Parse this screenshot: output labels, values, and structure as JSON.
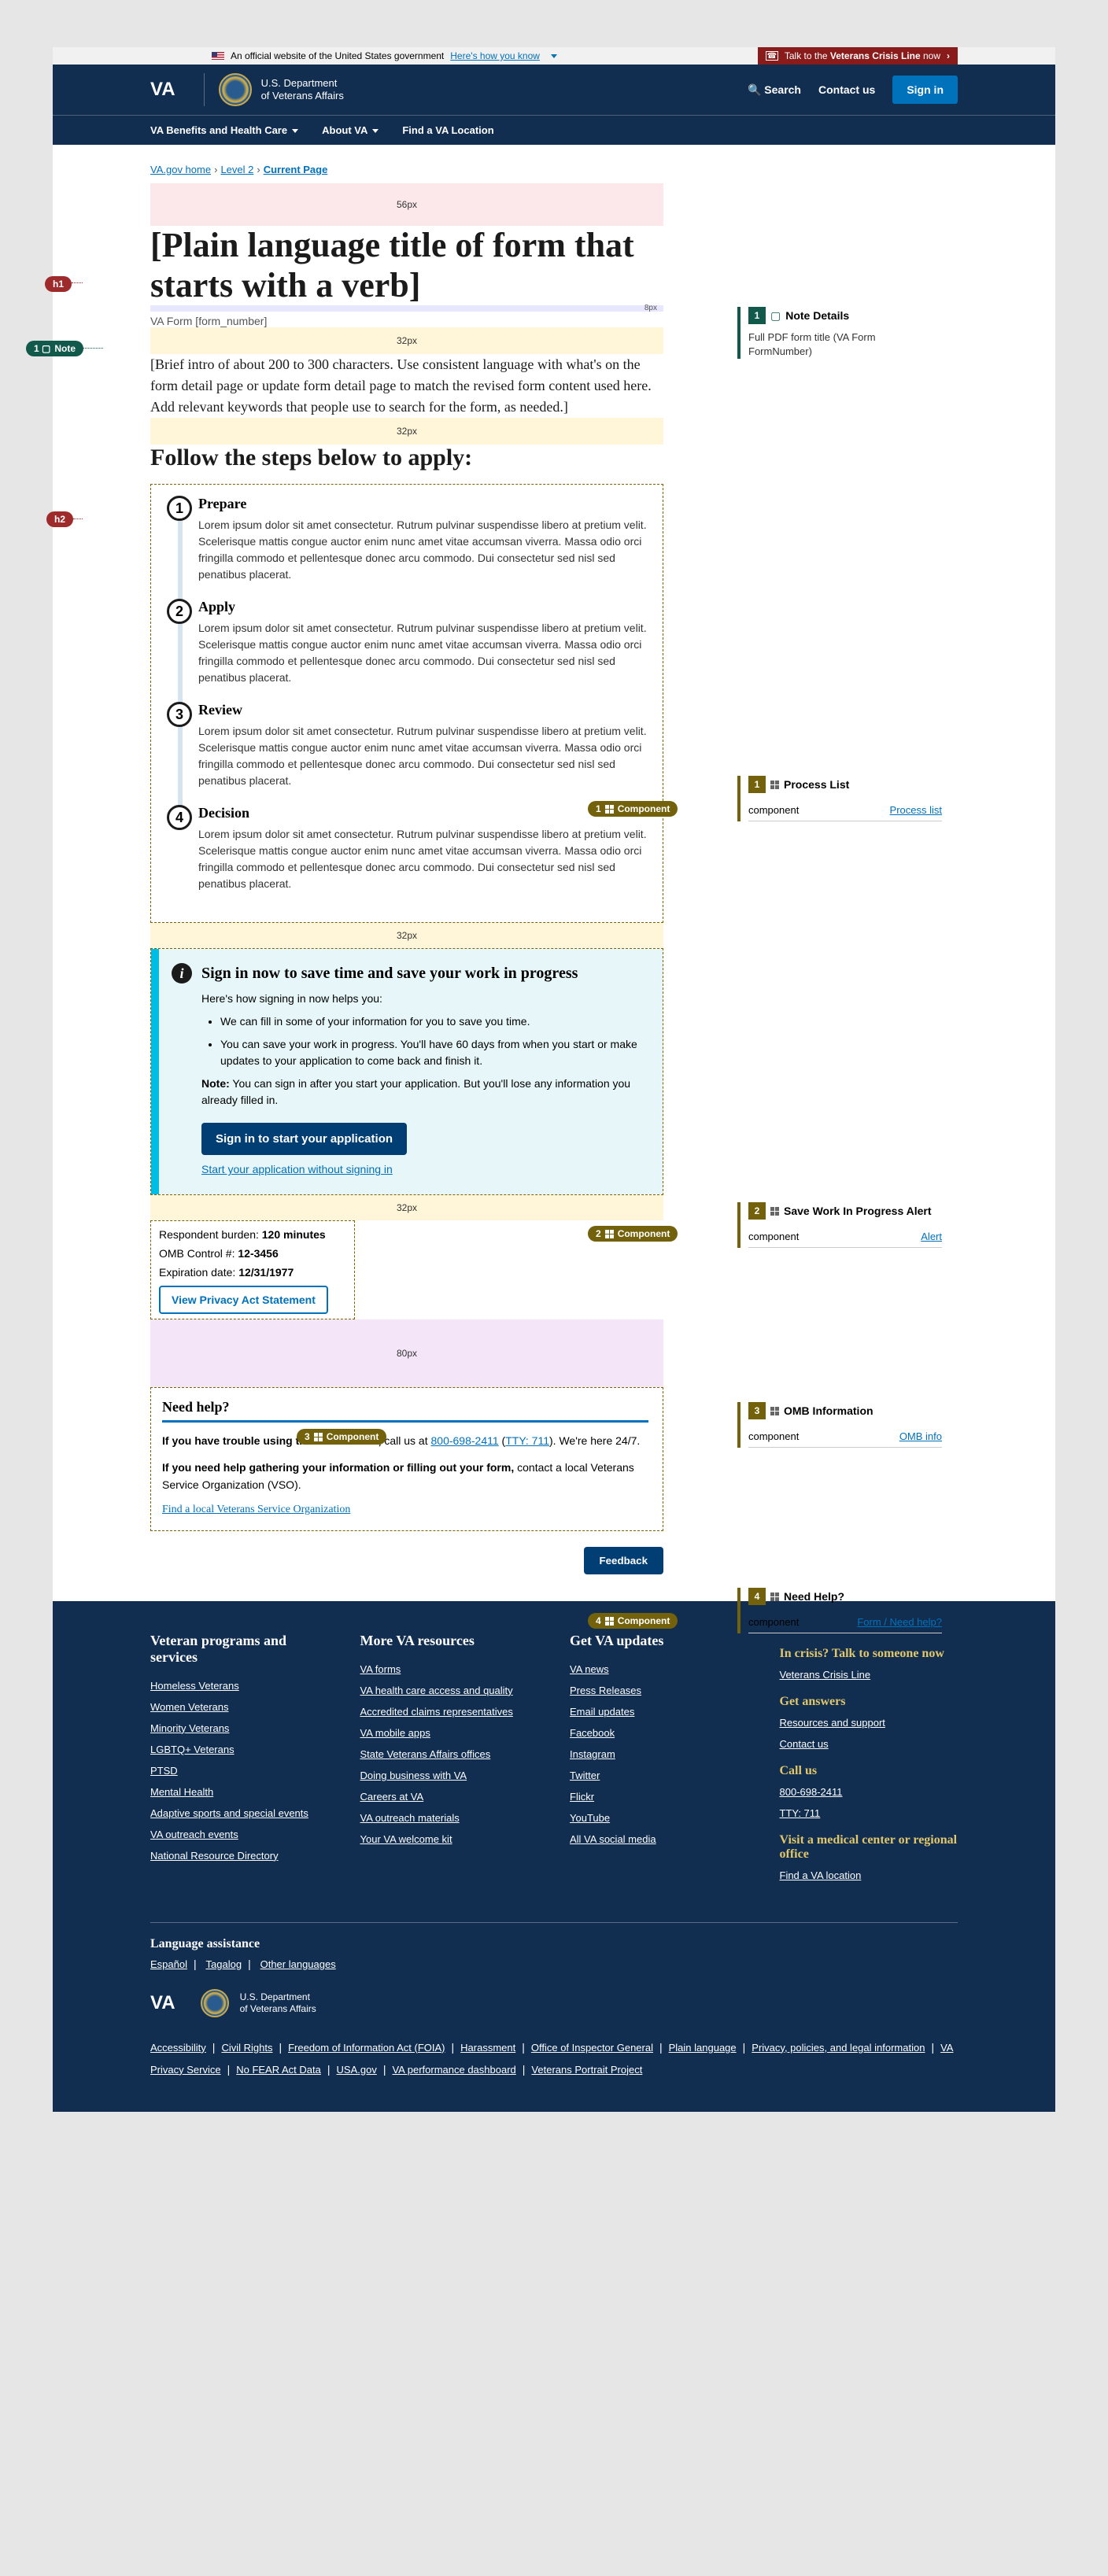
{
  "gov_banner": {
    "text": "An official website of the United States government",
    "link": "Here's how you know"
  },
  "crisis": {
    "prefix": "Talk to the",
    "bold": "Veterans Crisis Line",
    "suffix": "now"
  },
  "header": {
    "dept1": "U.S. Department",
    "dept2": "of Veterans Affairs",
    "search": "Search",
    "contact": "Contact us",
    "signin": "Sign in"
  },
  "nav": {
    "benefits": "VA Benefits and Health Care",
    "about": "About VA",
    "find": "Find a VA Location"
  },
  "breadcrumb": {
    "l1": "VA.gov home",
    "l2": "Level 2",
    "l3": "Current Page"
  },
  "spacers": {
    "pink": "56px",
    "blue": "8px",
    "yellow": "32px",
    "purple": "80px"
  },
  "title": "[Plain language title of form that starts with a verb]",
  "subtitle": "VA Form [form_number]",
  "intro": "[Brief intro of about 200 to 300 characters. Use consistent language with what's on the form detail page or update form detail page to match the revised form content used here. Add relevant keywords that people use to search for the form, as needed.]",
  "h2": "Follow the steps below to apply:",
  "steps": [
    {
      "title": "Prepare",
      "body": "Lorem ipsum dolor sit amet consectetur. Rutrum pulvinar suspendisse libero at pretium velit. Scelerisque mattis congue auctor enim nunc amet vitae accumsan viverra. Massa odio orci fringilla commodo et pellentesque donec arcu commodo. Dui consectetur sed nisl sed penatibus placerat."
    },
    {
      "title": "Apply",
      "body": "Lorem ipsum dolor sit amet consectetur. Rutrum pulvinar suspendisse libero at pretium velit. Scelerisque mattis congue auctor enim nunc amet vitae accumsan viverra. Massa odio orci fringilla commodo et pellentesque donec arcu commodo. Dui consectetur sed nisl sed penatibus placerat."
    },
    {
      "title": "Review",
      "body": "Lorem ipsum dolor sit amet consectetur. Rutrum pulvinar suspendisse libero at pretium velit. Scelerisque mattis congue auctor enim nunc amet vitae accumsan viverra. Massa odio orci fringilla commodo et pellentesque donec arcu commodo. Dui consectetur sed nisl sed penatibus placerat."
    },
    {
      "title": "Decision",
      "body": "Lorem ipsum dolor sit amet consectetur. Rutrum pulvinar suspendisse libero at pretium velit. Scelerisque mattis congue auctor enim nunc amet vitae accumsan viverra. Massa odio orci fringilla commodo et pellentesque donec arcu commodo. Dui consectetur sed nisl sed penatibus placerat."
    }
  ],
  "alert": {
    "title": "Sign in now to save time and save your work in progress",
    "lead": "Here's how signing in now helps you:",
    "b1": "We can fill in some of your information for you to save you time.",
    "b2": "You can save your work in progress. You'll have 60 days from when you start or make updates to your application to come back and finish it.",
    "note_label": "Note:",
    "note": " You can sign in after you start your application. But you'll lose any information you already filled in.",
    "btn": "Sign in to start your application",
    "link": "Start your application without signing in"
  },
  "omb": {
    "burden_label": "Respondent burden:",
    "burden": "120 minutes",
    "ctrl_label": "OMB Control #:",
    "ctrl": "12-3456",
    "exp_label": "Expiration date:",
    "exp": "12/31/1977",
    "btn": "View Privacy Act Statement"
  },
  "help": {
    "heading": "Need help?",
    "p1a": "If you have trouble using this online form,",
    "p1b": " call us at ",
    "phone": "800-698-2411",
    "tty": "TTY: 711",
    "p1c": ". We're here 24/7.",
    "p2a": "If you need help gathering your information or filling out your form,",
    "p2b": " contact a local Veterans Service Organization (VSO).",
    "link": "Find a local Veterans Service Organization"
  },
  "feedback": "Feedback",
  "ann": {
    "h1": "h1",
    "h2": "h2",
    "note": "Note",
    "comp": "Component"
  },
  "side": {
    "note": {
      "title": "Note Details",
      "body": "Full PDF form title (VA Form FormNumber)"
    },
    "c1": {
      "title": "Process List",
      "label": "component",
      "link": "Process list"
    },
    "c2": {
      "title": "Save Work In Progress Alert",
      "label": "component",
      "link": "Alert"
    },
    "c3": {
      "title": "OMB Information",
      "label": "component",
      "link": "OMB info"
    },
    "c4": {
      "title": "Need Help?",
      "label": "component",
      "link": "Form / Need help?"
    }
  },
  "footer": {
    "col1": {
      "h": "Veteran programs and services",
      "links": [
        "Homeless Veterans",
        "Women Veterans",
        "Minority Veterans",
        "LGBTQ+ Veterans",
        "PTSD",
        "Mental Health",
        "Adaptive sports and special events",
        "VA outreach events",
        "National Resource Directory"
      ]
    },
    "col2": {
      "h": "More VA resources",
      "links": [
        "VA forms",
        "VA health care access and quality",
        "Accredited claims representatives",
        "VA mobile apps",
        "State Veterans Affairs offices",
        "Doing business with VA",
        "Careers at VA",
        "VA outreach materials",
        "Your VA welcome kit"
      ]
    },
    "col3": {
      "h": "Get VA updates",
      "links": [
        "VA news",
        "Press Releases",
        "Email updates",
        "Facebook",
        "Instagram",
        "Twitter",
        "Flickr",
        "YouTube",
        "All VA social media"
      ]
    },
    "col4": {
      "crisis_h": "In crisis? Talk to someone now",
      "crisis_link": "Veterans Crisis Line",
      "answers_h": "Get answers",
      "answers_links": [
        "Resources and support",
        "Contact us"
      ],
      "call_h": "Call us",
      "call_links": [
        "800-698-2411",
        "TTY: 711"
      ],
      "visit_h": "Visit a medical center or regional office",
      "visit_link": "Find a VA location"
    },
    "lang_h": "Language assistance",
    "lang": [
      "Español",
      "Tagalog",
      "Other languages"
    ],
    "bottom": [
      "Accessibility",
      "Civil Rights",
      "Freedom of Information Act (FOIA)",
      "Harassment",
      "Office of Inspector General",
      "Plain language",
      "Privacy, policies, and legal information",
      "VA Privacy Service",
      "No FEAR Act Data",
      "USA.gov",
      "VA performance dashboard",
      "Veterans Portrait Project"
    ]
  }
}
